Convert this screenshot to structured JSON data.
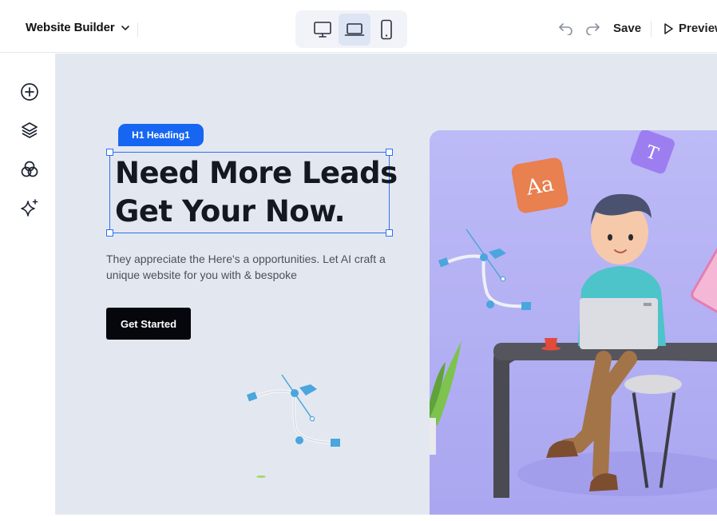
{
  "header": {
    "brand_label": "Website Builder",
    "devices": [
      "desktop",
      "laptop",
      "mobile"
    ],
    "active_device": "laptop",
    "save_label": "Save",
    "preview_label": "Preview"
  },
  "sidebar": {
    "items": [
      {
        "icon": "add-icon"
      },
      {
        "icon": "layers-icon"
      },
      {
        "icon": "components-icon"
      },
      {
        "icon": "ai-sparkle-icon"
      }
    ]
  },
  "canvas": {
    "selection_badge": "H1 Heading1",
    "headline_line1": "Need More Leads",
    "headline_line2": "Get Your Now.",
    "description": "They appreciate the   Here's a opportunities. Let AI craft a unique website for you with & bespoke",
    "cta_label": "Get Started",
    "illustration": {
      "tile_aa": "Aa",
      "tile_t": "T"
    }
  },
  "colors": {
    "accent": "#1766f2",
    "canvas_bg": "#e3e8f0",
    "hero_bg": "#b7b4f6",
    "button_bg": "#05070d"
  }
}
